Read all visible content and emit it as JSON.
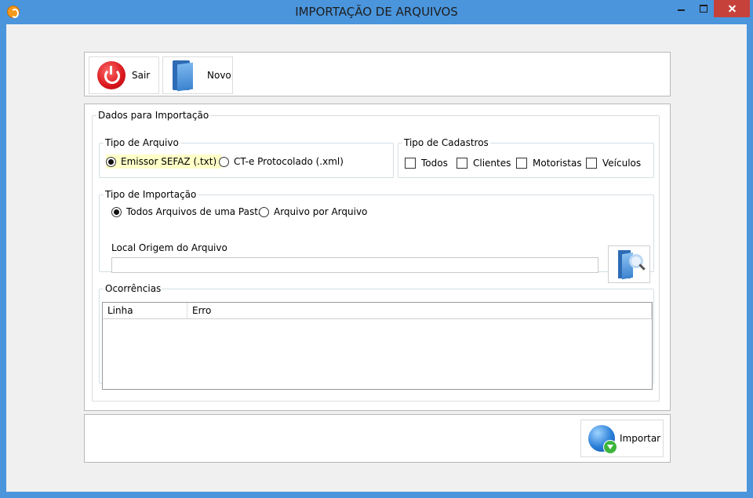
{
  "window": {
    "title": "IMPORTAÇÃO DE ARQUIVOS"
  },
  "toolbar": {
    "exit_label": "Sair",
    "new_label": "Novo"
  },
  "dados": {
    "legend": "Dados para Importação",
    "tipo_arquivo": {
      "legend": "Tipo de Arquivo",
      "options": [
        {
          "label": "Emissor SEFAZ (.txt)",
          "selected": true
        },
        {
          "label": "CT-e Protocolado (.xml)",
          "selected": false
        }
      ]
    },
    "tipo_cadastros": {
      "legend": "Tipo de Cadastros",
      "options": [
        {
          "label": "Todos",
          "checked": false
        },
        {
          "label": "Clientes",
          "checked": false
        },
        {
          "label": "Motoristas",
          "checked": false
        },
        {
          "label": "Veículos",
          "checked": false
        }
      ]
    },
    "tipo_importacao": {
      "legend": "Tipo de Importação",
      "options": [
        {
          "label": "Todos Arquivos de uma Pasta",
          "selected": true
        },
        {
          "label": "Arquivo por Arquivo",
          "selected": false
        }
      ],
      "local_label": "Local Origem do Arquivo",
      "local_value": ""
    },
    "ocorrencias": {
      "legend": "Ocorrências",
      "columns": [
        "Linha",
        "Erro"
      ],
      "rows": []
    }
  },
  "footer": {
    "import_label": "Importar"
  }
}
